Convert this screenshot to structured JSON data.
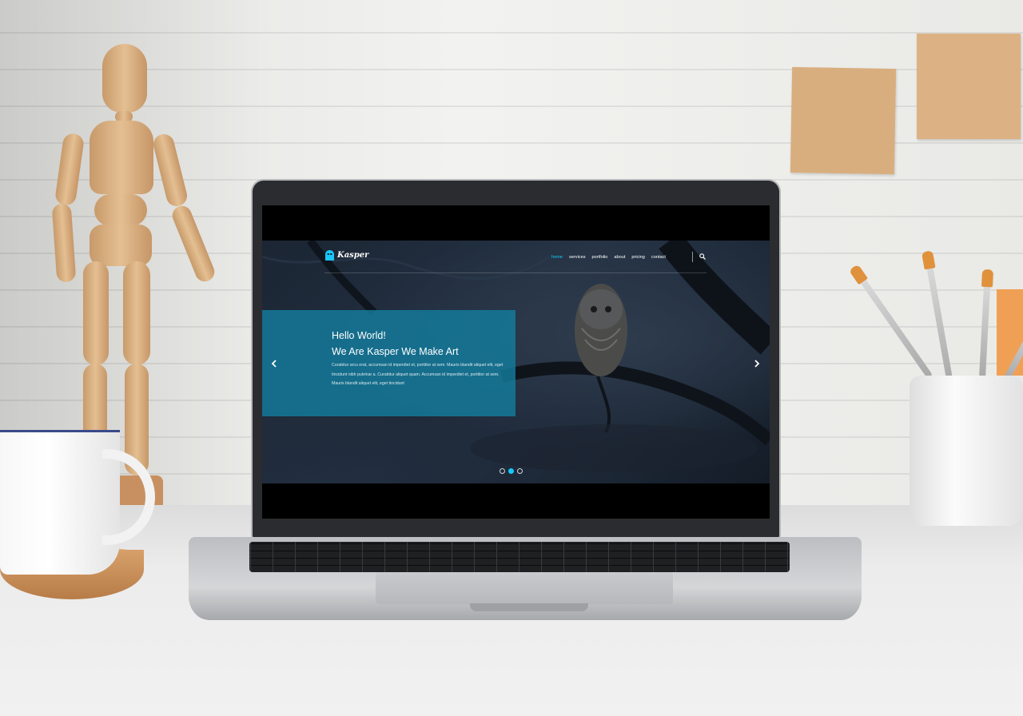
{
  "site": {
    "logo_text": "Kasper",
    "nav": {
      "items": [
        {
          "label": "home",
          "active": true
        },
        {
          "label": "services",
          "active": false
        },
        {
          "label": "portfolio",
          "active": false
        },
        {
          "label": "about",
          "active": false
        },
        {
          "label": "pricing",
          "active": false
        },
        {
          "label": "contact",
          "active": false
        }
      ],
      "search_icon": "search-icon"
    },
    "slider": {
      "title_line1": "Hello World!",
      "title_line2": "We Are Kasper We Make Art",
      "text": "Curabitur arcu erat, accumsan id imperdiet et, porttitor at sem. Mauris blandit aliquet elit, eget tincidunt nibh pulvinar a. Curabitur aliquet quam. Accumsan id imperdiet et, porttitor at sem. Mauris blandit aliquet elit, eget tincidunt",
      "prev_icon": "chevron-left-icon",
      "next_icon": "chevron-right-icon",
      "dots": 3,
      "active_dot": 2
    },
    "colors": {
      "accent": "#19c8fa",
      "caption_bg": "#147c9e"
    }
  }
}
